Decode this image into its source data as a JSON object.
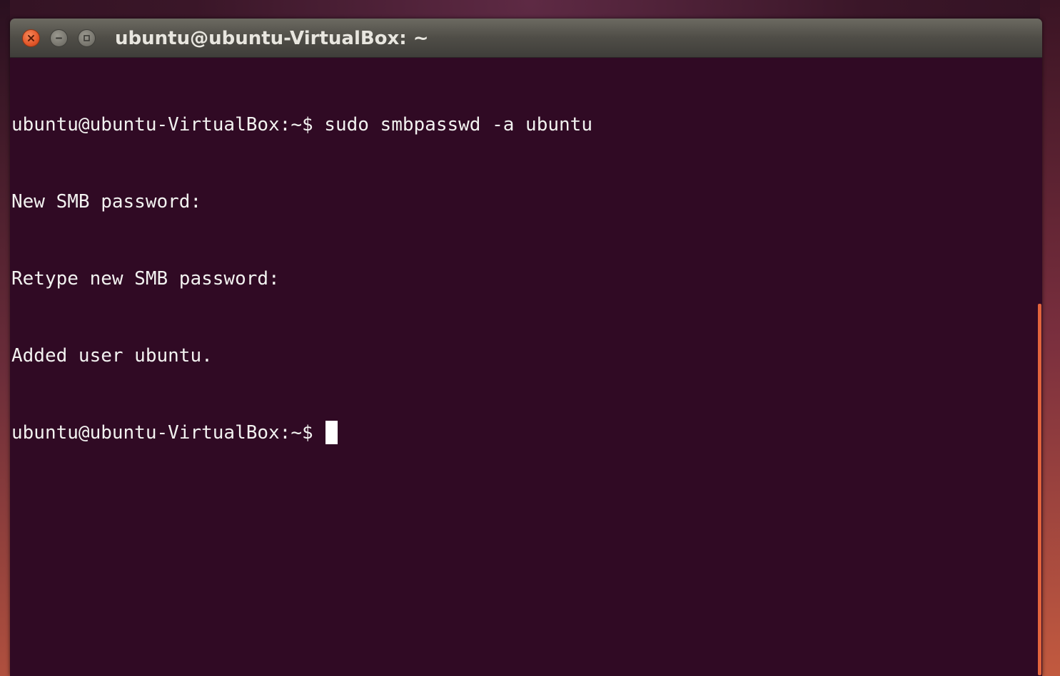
{
  "window": {
    "title": "ubuntu@ubuntu-VirtualBox: ~",
    "buttons": {
      "close_icon": "close-icon",
      "minimize_icon": "minimize-icon",
      "maximize_icon": "maximize-icon"
    }
  },
  "terminal": {
    "lines": [
      "ubuntu@ubuntu-VirtualBox:~$ sudo smbpasswd -a ubuntu",
      "New SMB password:",
      "Retype new SMB password:",
      "Added user ubuntu."
    ],
    "prompt": "ubuntu@ubuntu-VirtualBox:~$ "
  },
  "colors": {
    "terminal_background": "#300a24",
    "terminal_text": "#f2f2f0",
    "close_button": "#e3572a",
    "scrollbar_accent": "#e2643d",
    "titlebar": "#4f4d47"
  }
}
